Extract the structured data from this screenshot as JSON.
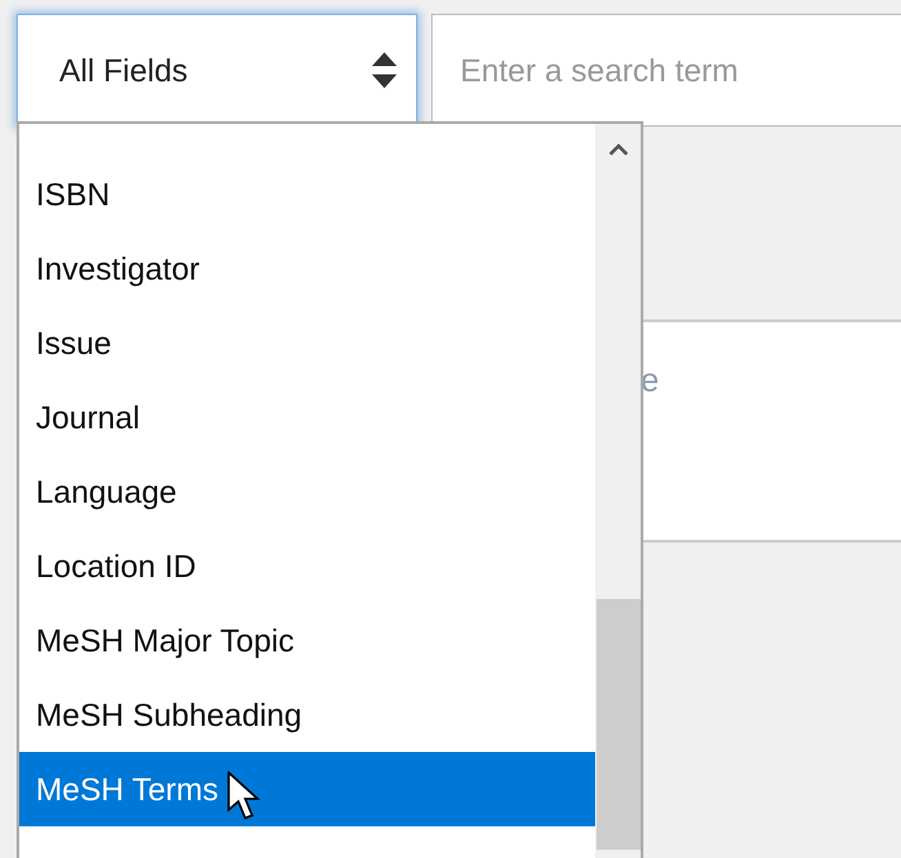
{
  "field_select": {
    "value": "All Fields"
  },
  "search": {
    "placeholder": "Enter a search term"
  },
  "background_panel": {
    "text": "e"
  },
  "dropdown": {
    "items": [
      {
        "label": "ISBN",
        "selected": false
      },
      {
        "label": "Investigator",
        "selected": false
      },
      {
        "label": "Issue",
        "selected": false
      },
      {
        "label": "Journal",
        "selected": false
      },
      {
        "label": "Language",
        "selected": false
      },
      {
        "label": "Location ID",
        "selected": false
      },
      {
        "label": "MeSH Major Topic",
        "selected": false
      },
      {
        "label": "MeSH Subheading",
        "selected": false
      },
      {
        "label": "MeSH Terms",
        "selected": true
      }
    ]
  }
}
